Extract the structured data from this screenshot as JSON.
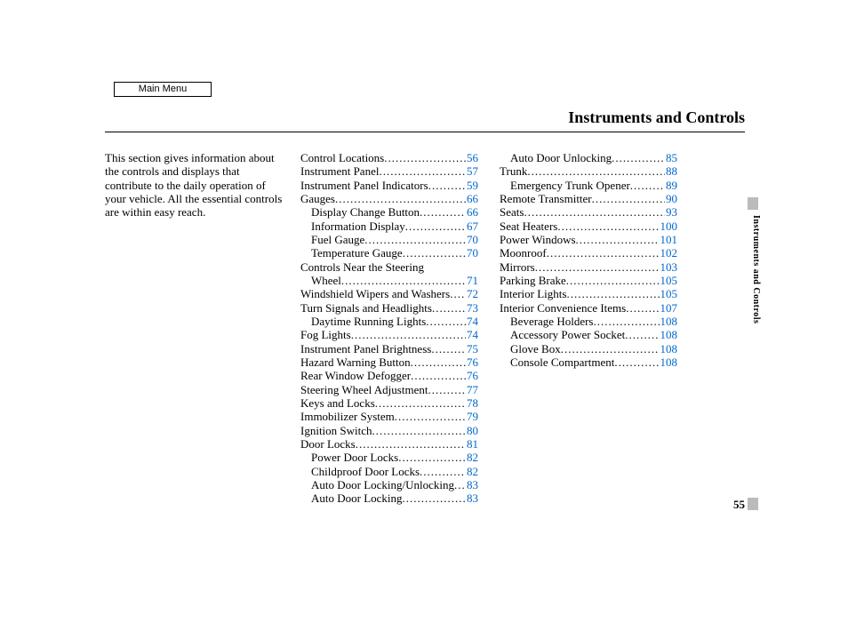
{
  "menu_button": "Main Menu",
  "title": "Instruments and Controls",
  "intro": "This section gives information about the controls and displays that contribute to the daily operation of your vehicle. All the essential controls are within easy reach.",
  "side_label": "Instruments and Controls",
  "page_number": "55",
  "col1": [
    {
      "label": "Control Locations",
      "page": "56",
      "indent": 0
    },
    {
      "label": "Instrument Panel",
      "page": "57",
      "indent": 0
    },
    {
      "label": "Instrument Panel Indicators",
      "page": "59",
      "indent": 0
    },
    {
      "label": "Gauges",
      "page": "66",
      "indent": 0
    },
    {
      "label": "Display Change Button",
      "page": "66",
      "indent": 1
    },
    {
      "label": "Information Display",
      "page": "67",
      "indent": 1
    },
    {
      "label": "Fuel Gauge",
      "page": "70",
      "indent": 1
    },
    {
      "label": "Temperature Gauge",
      "page": "70",
      "indent": 1
    },
    {
      "label": "Controls Near the Steering",
      "page": "",
      "indent": 0,
      "nodots": true
    },
    {
      "label": "Wheel",
      "page": "71",
      "indent": 1
    },
    {
      "label": "Windshield Wipers and Washers",
      "page": "72",
      "indent": 0
    },
    {
      "label": "Turn Signals and Headlights",
      "page": "73",
      "indent": 0
    },
    {
      "label": "Daytime Running Lights",
      "page": "74",
      "indent": 1
    },
    {
      "label": "Fog Lights",
      "page": "74",
      "indent": 0
    },
    {
      "label": "Instrument Panel Brightness",
      "page": "75",
      "indent": 0
    },
    {
      "label": "Hazard Warning Button",
      "page": "76",
      "indent": 0
    },
    {
      "label": "Rear Window Defogger",
      "page": "76",
      "indent": 0
    },
    {
      "label": "Steering Wheel Adjustment",
      "page": "77",
      "indent": 0
    },
    {
      "label": "Keys and Locks",
      "page": "78",
      "indent": 0
    },
    {
      "label": "Immobilizer System",
      "page": "79",
      "indent": 0
    },
    {
      "label": "Ignition Switch",
      "page": "80",
      "indent": 0
    },
    {
      "label": "Door Locks",
      "page": "81",
      "indent": 0
    },
    {
      "label": "Power Door Locks",
      "page": "82",
      "indent": 1
    },
    {
      "label": "Childproof Door Locks",
      "page": "82",
      "indent": 1
    },
    {
      "label": "Auto Door Locking/Unlocking",
      "page": "83",
      "indent": 1
    },
    {
      "label": "Auto Door Locking",
      "page": "83",
      "indent": 1
    }
  ],
  "col2": [
    {
      "label": "Auto Door Unlocking",
      "page": "85",
      "indent": 1
    },
    {
      "label": "Trunk",
      "page": "88",
      "indent": 0
    },
    {
      "label": "Emergency Trunk Opener",
      "page": "89",
      "indent": 1
    },
    {
      "label": "Remote Transmitter",
      "page": "90",
      "indent": 0
    },
    {
      "label": "Seats",
      "page": "93",
      "indent": 0
    },
    {
      "label": "Seat Heaters",
      "page": "100",
      "indent": 0
    },
    {
      "label": "Power Windows",
      "page": "101",
      "indent": 0
    },
    {
      "label": "Moonroof",
      "page": "102",
      "indent": 0
    },
    {
      "label": "Mirrors",
      "page": "103",
      "indent": 0
    },
    {
      "label": "Parking Brake",
      "page": "105",
      "indent": 0
    },
    {
      "label": "Interior Lights",
      "page": "105",
      "indent": 0
    },
    {
      "label": "Interior Convenience Items",
      "page": "107",
      "indent": 0
    },
    {
      "label": "Beverage Holders",
      "page": "108",
      "indent": 1
    },
    {
      "label": "Accessory Power Socket",
      "page": "108",
      "indent": 1
    },
    {
      "label": "Glove Box",
      "page": "108",
      "indent": 1
    },
    {
      "label": "Console Compartment",
      "page": "108",
      "indent": 1
    }
  ]
}
